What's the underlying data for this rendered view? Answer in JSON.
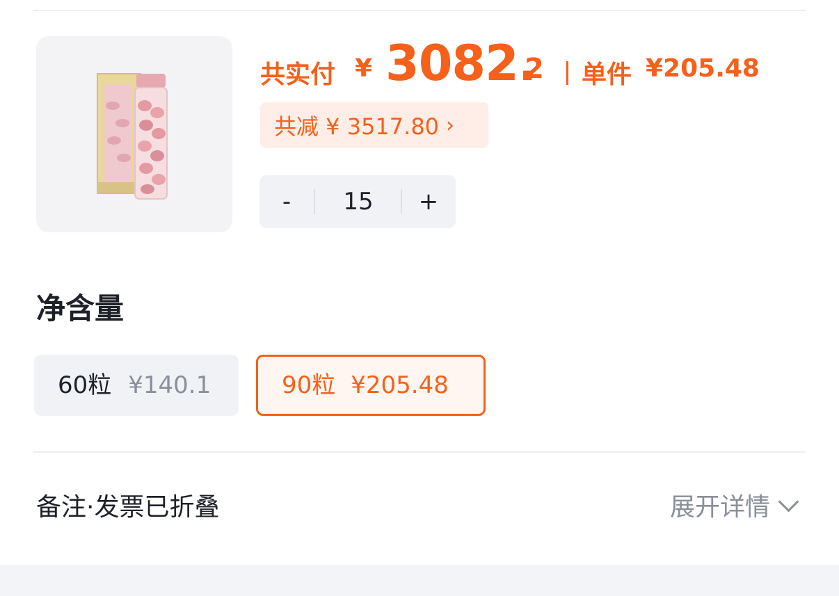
{
  "product": {
    "image_icon": "product-bottle-image",
    "price_label": "共实付",
    "currency": "¥",
    "total_integer": "3082.",
    "total_decimal": "2",
    "unit_label": "单件",
    "unit_price": "¥205.48",
    "discount_text": "共减 ¥ 3517.80",
    "discount_chevron": "›",
    "quantity": "15",
    "minus_label": "-",
    "plus_label": "+"
  },
  "spec": {
    "title": "净含量",
    "options": [
      {
        "label": "60粒",
        "price": "¥140.1",
        "selected": false
      },
      {
        "label": "90粒",
        "price": "¥205.48",
        "selected": true
      }
    ]
  },
  "footer": {
    "remarks": "备注·发票已折叠",
    "expand": "展开详情"
  },
  "colors": {
    "accent": "#f5601a",
    "pill_bg": "#ffeee7",
    "stepper_bg": "#f0f2f6"
  }
}
